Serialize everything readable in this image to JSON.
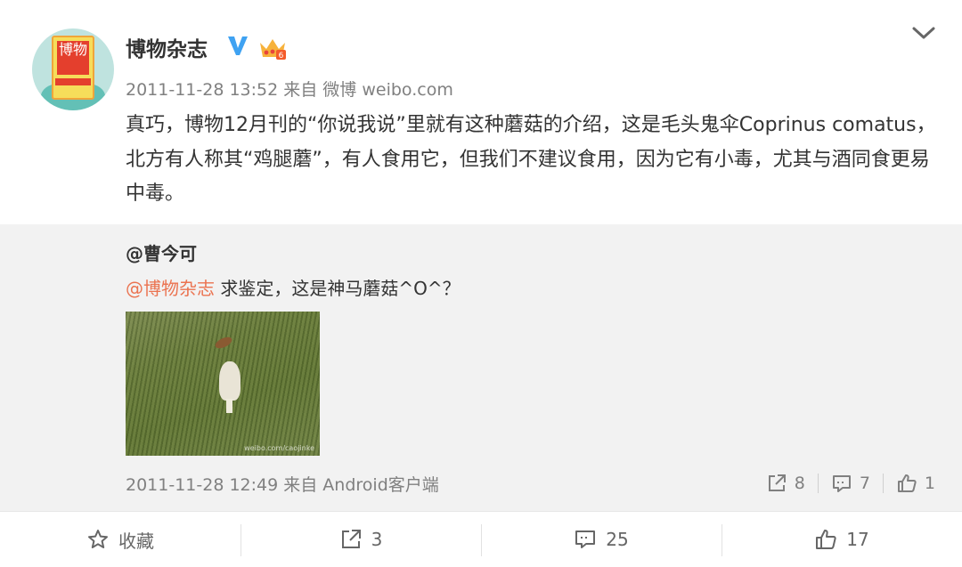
{
  "post": {
    "author": "博物杂志",
    "avatar_text": "博物",
    "timestamp": "2011-11-28 13:52",
    "source": "来自 微博 weibo.com",
    "text": "真巧，博物12月刊的“你说我说”里就有这种蘑菇的介绍，这是毛头鬼伞Coprinus comatus，北方有人称其“鸡腿蘑”，有人食用它，但我们不建议食用，因为它有小毒，尤其与酒同食更易中毒。",
    "verified_icon": "verified-v-icon",
    "badge_icon": "crown-badge-icon",
    "menu_icon": "chevron-down-icon"
  },
  "repost": {
    "user": "@曹今可",
    "mention": "@博物杂志",
    "text": " 求鉴定，这是神马蘑菇^O^？",
    "image_alt": "mushroom-photo",
    "watermark": "weibo.com/caojinke",
    "timestamp": "2011-11-28 12:49",
    "source": "来自 Android客户端",
    "actions": {
      "repost": "8",
      "comment": "7",
      "like": "1"
    }
  },
  "bottom_bar": {
    "favorite": "收藏",
    "repost": "3",
    "comment": "25",
    "like": "17"
  },
  "colors": {
    "mention": "#eb7350",
    "meta": "#808080",
    "repost_bg": "#f2f2f2",
    "verified": "#ffa600"
  }
}
